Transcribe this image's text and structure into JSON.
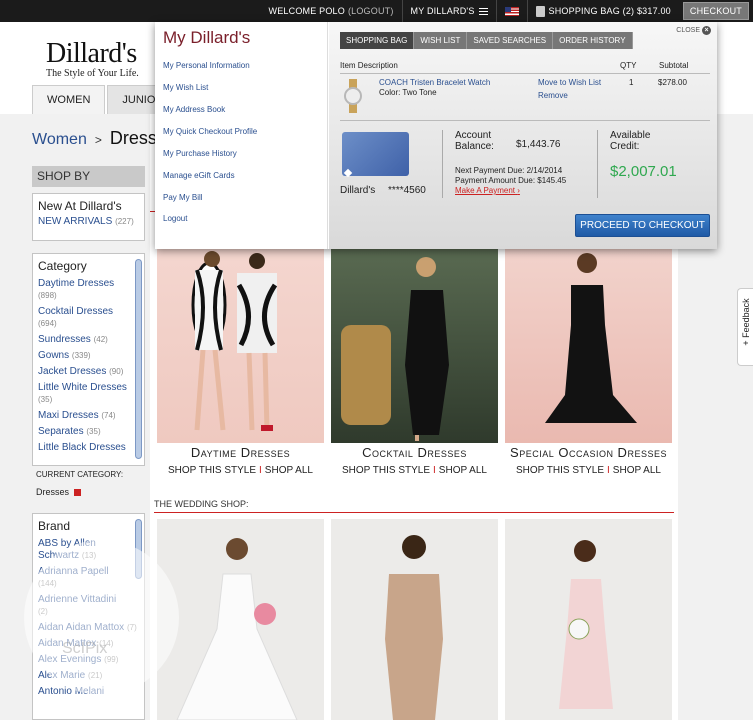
{
  "topbar": {
    "welcome": "WELCOME POLO",
    "logout": "(LOGOUT)",
    "my_dillards": "MY DILLARD'S",
    "shopping_bag": "SHOPPING BAG (2) $317.00",
    "checkout": "CHECKOUT"
  },
  "header": {
    "logo": "Dillard's",
    "tagline": "The Style of Your Life.",
    "tabs": [
      "WOMEN",
      "JUNIORS"
    ]
  },
  "breadcrumb": {
    "root": "Women",
    "separator": ">",
    "current": "Dresses"
  },
  "sidebar": {
    "shop_by": "SHOP BY",
    "new_at": {
      "title": "New At Dillard's",
      "link": "NEW ARRIVALS",
      "count": "(227)"
    },
    "category": {
      "title": "Category",
      "items": [
        {
          "label": "Daytime Dresses",
          "count": "(898)"
        },
        {
          "label": "Cocktail Dresses",
          "count": "(694)"
        },
        {
          "label": "Sundresses",
          "count": "(42)"
        },
        {
          "label": "Gowns",
          "count": "(339)"
        },
        {
          "label": "Jacket Dresses",
          "count": "(90)"
        },
        {
          "label": "Little White Dresses",
          "count": "(35)"
        },
        {
          "label": "Maxi Dresses",
          "count": "(74)"
        },
        {
          "label": "Separates",
          "count": "(35)"
        },
        {
          "label": "Little Black Dresses",
          "count": ""
        }
      ],
      "current_label": "CURRENT CATEGORY:",
      "current_value": "Dresses"
    },
    "brand": {
      "title": "Brand",
      "items": [
        {
          "label": "ABS by Allen Schwartz",
          "count": "(13)"
        },
        {
          "label": "Adrianna Papell",
          "count": "(144)"
        },
        {
          "label": "Adrienne Vittadini",
          "count": "(2)"
        },
        {
          "label": "Aidan Aidan Mattox",
          "count": "(7)"
        },
        {
          "label": "Aidan Mattox",
          "count": "(14)"
        },
        {
          "label": "Alex Evenings",
          "count": "(99)"
        },
        {
          "label": "Alex Marie",
          "count": "(21)"
        },
        {
          "label": "Antonio Melani",
          "count": ""
        }
      ]
    }
  },
  "products": [
    {
      "caption": "Daytime Dresses",
      "shop_style": "SHOP THIS STYLE",
      "sep": "I",
      "shop_all": "SHOP ALL"
    },
    {
      "caption": "Cocktail Dresses",
      "shop_style": "SHOP THIS STYLE",
      "sep": "I",
      "shop_all": "SHOP ALL"
    },
    {
      "caption": "Special Occasion Dresses",
      "shop_style": "SHOP THIS STYLE",
      "sep": "I",
      "shop_all": "SHOP ALL"
    }
  ],
  "wedding": {
    "title": "THE WEDDING SHOP:"
  },
  "feedback": "+ Feedback",
  "watermark": "ScIPix",
  "dropdown": {
    "title": "My Dillard's",
    "links": [
      "My Personal Information",
      "My Wish List",
      "My Address Book",
      "My Quick Checkout Profile",
      "My Purchase History",
      "Manage eGift Cards",
      "Pay My Bill",
      "Logout"
    ],
    "tabs": [
      "SHOPPING BAG",
      "WISH LIST",
      "SAVED SEARCHES",
      "ORDER HISTORY"
    ],
    "close": "CLOSE",
    "columns": {
      "desc": "Item Description",
      "qty": "QTY",
      "subtotal": "Subtotal"
    },
    "item": {
      "name": "COACH Tristen Bracelet Watch",
      "color": "Color: Two Tone",
      "move": "Move to Wish List",
      "remove": "Remove",
      "qty": "1",
      "subtotal": "$278.00"
    },
    "account": {
      "card_name": "Dillard's",
      "card_number": "****4560",
      "balance_label1": "Account",
      "balance_label2": "Balance:",
      "balance_value": "$1,443.76",
      "next_payment": "Next Payment Due: 2/14/2014",
      "payment_amount": "Payment Amount Due: $145.45",
      "make_payment": "Make A Payment",
      "available_label1": "Available",
      "available_label2": "Credit:",
      "available_value": "$2,007.01"
    },
    "proceed": "PROCEED TO CHECKOUT"
  },
  "colors": {
    "link": "#2a4f8f",
    "accent_red": "#c22222",
    "credit_green": "#2fa84f",
    "proceed_blue": "#2a6cb8"
  }
}
